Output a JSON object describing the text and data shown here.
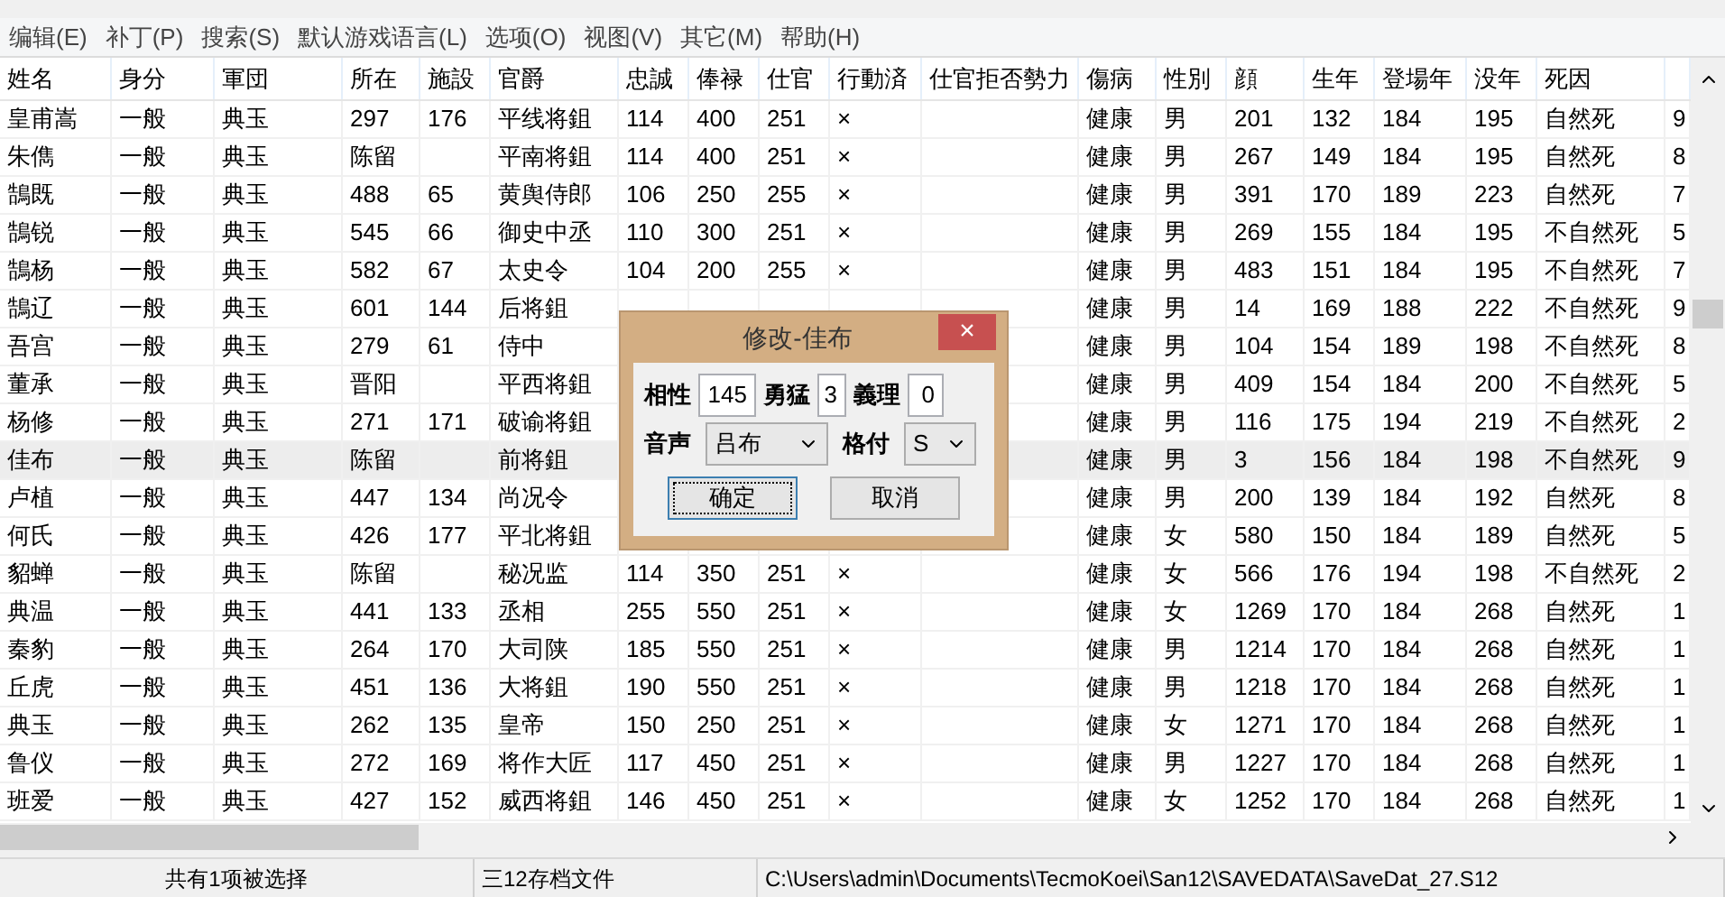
{
  "menu": [
    "编辑(E)",
    "补丁(P)",
    "搜索(S)",
    "默认游戏语言(L)",
    "选项(O)",
    "视图(V)",
    "其它(M)",
    "帮助(H)"
  ],
  "table": {
    "columns": [
      "姓名",
      "身分",
      "軍団",
      "所在",
      "施設",
      "官爵",
      "忠誠",
      "俸禄",
      "仕官",
      "行動済",
      "仕官拒否勢力",
      "傷病",
      "性別",
      "顔",
      "生年",
      "登場年",
      "没年",
      "死因"
    ],
    "rows": [
      {
        "selected": false,
        "cells": [
          "皇甫嵩",
          "一般",
          "典玉",
          "297",
          "176",
          "平线将鉏",
          "114",
          "400",
          "251",
          "×",
          null,
          "健康",
          "男",
          "201",
          "132",
          "184",
          "195",
          "自然死",
          "9"
        ]
      },
      {
        "selected": false,
        "cells": [
          "朱儁",
          "一般",
          "典玉",
          "陈留",
          null,
          "平南将鉏",
          "114",
          "400",
          "251",
          "×",
          null,
          "健康",
          "男",
          "267",
          "149",
          "184",
          "195",
          "自然死",
          "8"
        ]
      },
      {
        "selected": false,
        "cells": [
          "鵠既",
          "一般",
          "典玉",
          "488",
          "65",
          "黄舆侍郎",
          "106",
          "250",
          "255",
          "×",
          null,
          "健康",
          "男",
          "391",
          "170",
          "189",
          "223",
          "自然死",
          "7"
        ]
      },
      {
        "selected": false,
        "cells": [
          "鵠锐",
          "一般",
          "典玉",
          "545",
          "66",
          "御史中丞",
          "110",
          "300",
          "251",
          "×",
          null,
          "健康",
          "男",
          "269",
          "155",
          "184",
          "195",
          "不自然死",
          "5"
        ]
      },
      {
        "selected": false,
        "cells": [
          "鵠杨",
          "一般",
          "典玉",
          "582",
          "67",
          "太史令",
          "104",
          "200",
          "255",
          "×",
          null,
          "健康",
          "男",
          "483",
          "151",
          "184",
          "195",
          "不自然死",
          "7"
        ]
      },
      {
        "selected": false,
        "cells": [
          "鵠辽",
          "一般",
          "典玉",
          "601",
          "144",
          "后将鉏",
          null,
          null,
          null,
          null,
          null,
          "健康",
          "男",
          "14",
          "169",
          "188",
          "222",
          "不自然死",
          "9"
        ]
      },
      {
        "selected": false,
        "cells": [
          "吾宫",
          "一般",
          "典玉",
          "279",
          "61",
          "侍中",
          null,
          null,
          null,
          null,
          null,
          "健康",
          "男",
          "104",
          "154",
          "189",
          "198",
          "不自然死",
          "8"
        ]
      },
      {
        "selected": false,
        "cells": [
          "董承",
          "一般",
          "典玉",
          "晋阳",
          null,
          "平西将鉏",
          null,
          null,
          null,
          null,
          null,
          "健康",
          "男",
          "409",
          "154",
          "184",
          "200",
          "不自然死",
          "5"
        ]
      },
      {
        "selected": false,
        "cells": [
          "杨修",
          "一般",
          "典玉",
          "271",
          "171",
          "破谕将鉏",
          null,
          null,
          null,
          null,
          null,
          "健康",
          "男",
          "116",
          "175",
          "194",
          "219",
          "不自然死",
          "2"
        ]
      },
      {
        "selected": true,
        "cells": [
          "佳布",
          "一般",
          "典玉",
          "陈留",
          null,
          "前将鉏",
          null,
          null,
          null,
          null,
          null,
          "健康",
          "男",
          "3",
          "156",
          "184",
          "198",
          "不自然死",
          "9"
        ]
      },
      {
        "selected": false,
        "cells": [
          "卢植",
          "一般",
          "典玉",
          "447",
          "134",
          "尚况令",
          null,
          null,
          null,
          null,
          null,
          "健康",
          "男",
          "200",
          "139",
          "184",
          "192",
          "自然死",
          "8"
        ]
      },
      {
        "selected": false,
        "cells": [
          "何氏",
          "一般",
          "典玉",
          "426",
          "177",
          "平北将鉏",
          null,
          null,
          null,
          null,
          null,
          "健康",
          "女",
          "580",
          "150",
          "184",
          "189",
          "自然死",
          "5"
        ]
      },
      {
        "selected": false,
        "cells": [
          "貂蝉",
          "一般",
          "典玉",
          "陈留",
          null,
          "秘况监",
          "114",
          "350",
          "251",
          "×",
          null,
          "健康",
          "女",
          "566",
          "176",
          "194",
          "198",
          "不自然死",
          "2"
        ]
      },
      {
        "selected": false,
        "cells": [
          "典温",
          "一般",
          "典玉",
          "441",
          "133",
          "丞相",
          "255",
          "550",
          "251",
          "×",
          null,
          "健康",
          "女",
          "1269",
          "170",
          "184",
          "268",
          "自然死",
          "1"
        ]
      },
      {
        "selected": false,
        "cells": [
          "秦豹",
          "一般",
          "典玉",
          "264",
          "170",
          "大司陕",
          "185",
          "550",
          "251",
          "×",
          null,
          "健康",
          "男",
          "1214",
          "170",
          "184",
          "268",
          "自然死",
          "1"
        ]
      },
      {
        "selected": false,
        "cells": [
          "丘虎",
          "一般",
          "典玉",
          "451",
          "136",
          "大将鉏",
          "190",
          "550",
          "251",
          "×",
          null,
          "健康",
          "男",
          "1218",
          "170",
          "184",
          "268",
          "自然死",
          "1"
        ]
      },
      {
        "selected": false,
        "cells": [
          "典玉",
          "一般",
          "典玉",
          "262",
          "135",
          "皇帝",
          "150",
          "250",
          "251",
          "×",
          null,
          "健康",
          "女",
          "1271",
          "170",
          "184",
          "268",
          "自然死",
          "1"
        ]
      },
      {
        "selected": false,
        "cells": [
          "鲁仪",
          "一般",
          "典玉",
          "272",
          "169",
          "将作大匠",
          "117",
          "450",
          "251",
          "×",
          null,
          "健康",
          "男",
          "1227",
          "170",
          "184",
          "268",
          "自然死",
          "1"
        ]
      },
      {
        "selected": false,
        "cells": [
          "班爱",
          "一般",
          "典玉",
          "427",
          "152",
          "威西将鉏",
          "146",
          "450",
          "251",
          "×",
          null,
          "健康",
          "女",
          "1252",
          "170",
          "184",
          "268",
          "自然死",
          "1"
        ]
      }
    ]
  },
  "dialog": {
    "title": "修改-佳布",
    "close": "×",
    "inputs": [
      {
        "label": "相性",
        "value": "145"
      },
      {
        "label": "勇猛",
        "value": "3"
      },
      {
        "label": "義理",
        "value": "0"
      }
    ],
    "selects": [
      {
        "label": "音声",
        "value": "吕布"
      },
      {
        "label": "格付",
        "value": "S"
      }
    ],
    "buttons": [
      {
        "label": "确定",
        "focused": true
      },
      {
        "label": "取消",
        "focused": false
      }
    ]
  },
  "status_bar": [
    "共有1项被选择",
    "三12存档文件",
    "C:\\Users\\admin\\Documents\\TecmoKoei\\San12\\SAVEDATA\\SaveDat_27.S12"
  ]
}
